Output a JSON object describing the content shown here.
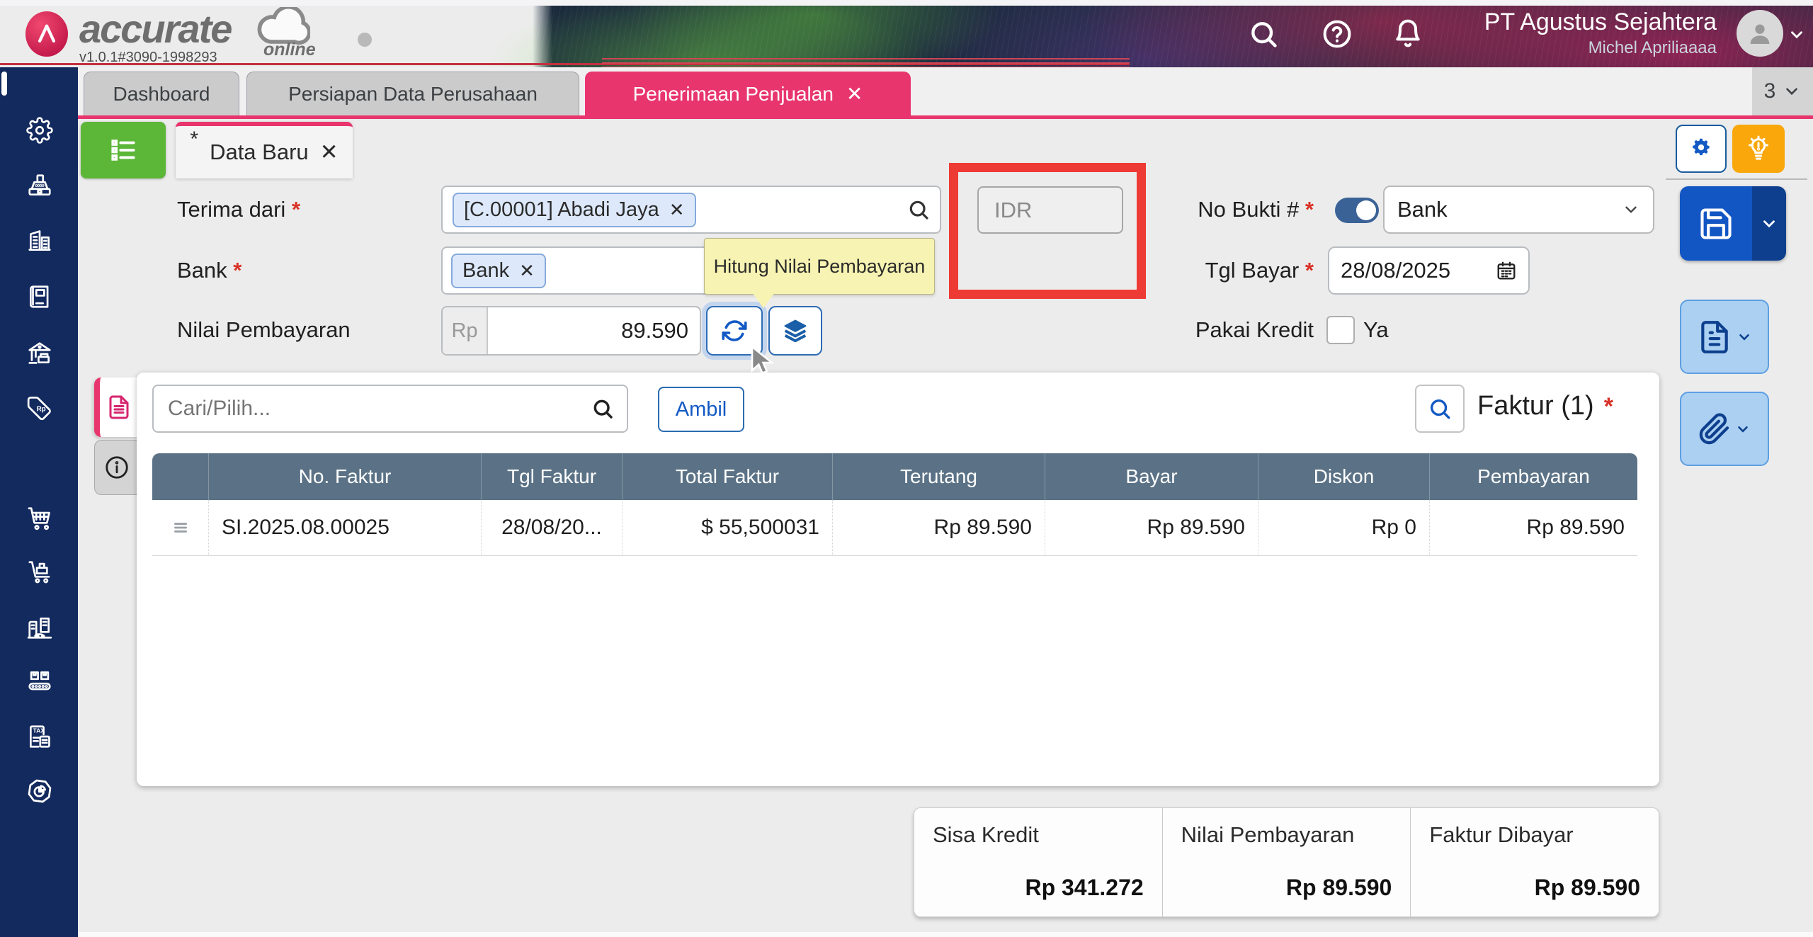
{
  "masthead": {
    "brand": "accurate",
    "brand_sub": "online",
    "version": "v1.0.1#3090-1998293",
    "company": "PT Agustus Sejahtera",
    "user": "Michel Apriliaaaa"
  },
  "window_tabs": {
    "items": [
      {
        "label": "Dashboard"
      },
      {
        "label": "Persiapan Data Perusahaan"
      },
      {
        "label": "Penerimaan Penjualan",
        "close_glyph": "✕"
      }
    ],
    "overflow_count": "3"
  },
  "form": {
    "doc_tab": {
      "dirty_marker": "*",
      "label": "Data Baru",
      "close_glyph": "✕"
    },
    "required_marker": "*",
    "terima_dari": {
      "label": "Terima dari",
      "chip": "[C.00001] Abadi Jaya",
      "chip_close": "✕"
    },
    "currency": {
      "value": "IDR"
    },
    "no_bukti": {
      "label": "No Bukti #",
      "selected": "Bank"
    },
    "bank": {
      "label": "Bank",
      "chip": "Bank",
      "chip_close": "✕"
    },
    "tgl_bayar": {
      "label": "Tgl Bayar",
      "value": "28/08/2025"
    },
    "nilai_pembayaran": {
      "label": "Nilai Pembayaran",
      "prefix": "Rp",
      "value": "89.590"
    },
    "pakai_kredit": {
      "label": "Pakai Kredit",
      "option": "Ya"
    },
    "tooltip": "Hitung Nilai Pembayaran"
  },
  "invoice_panel": {
    "search_placeholder": "Cari/Pilih...",
    "ambil_button": "Ambil",
    "title": "Faktur (1)",
    "title_required": "*",
    "table": {
      "headers": [
        "No. Faktur",
        "Tgl Faktur",
        "Total Faktur",
        "Terutang",
        "Bayar",
        "Diskon",
        "Pembayaran"
      ],
      "rows": [
        {
          "no_faktur": "SI.2025.08.00025",
          "tgl_faktur": "28/08/20...",
          "total_faktur": "$ 55,500031",
          "terutang": "Rp 89.590",
          "bayar": "Rp 89.590",
          "diskon": "Rp 0",
          "pembayaran": "Rp 89.590"
        }
      ]
    }
  },
  "summary": {
    "items": [
      {
        "label": "Sisa Kredit",
        "value": "Rp 341.272"
      },
      {
        "label": "Nilai Pembayaran",
        "value": "Rp 89.590"
      },
      {
        "label": "Faktur Dibayar",
        "value": "Rp 89.590"
      }
    ]
  },
  "icon_glyphs": {
    "rp_tag": "Rp",
    "tax": "TAX"
  },
  "colors": {
    "accent_pink": "#e8356d",
    "sidebar_navy": "#132a5e",
    "table_header": "#5b7286",
    "save_blue": "#1256c4",
    "light_blue_button": "#abd0f2",
    "orange": "#f9a70b",
    "green": "#5cb637",
    "annotation_red": "#ee3a34"
  }
}
